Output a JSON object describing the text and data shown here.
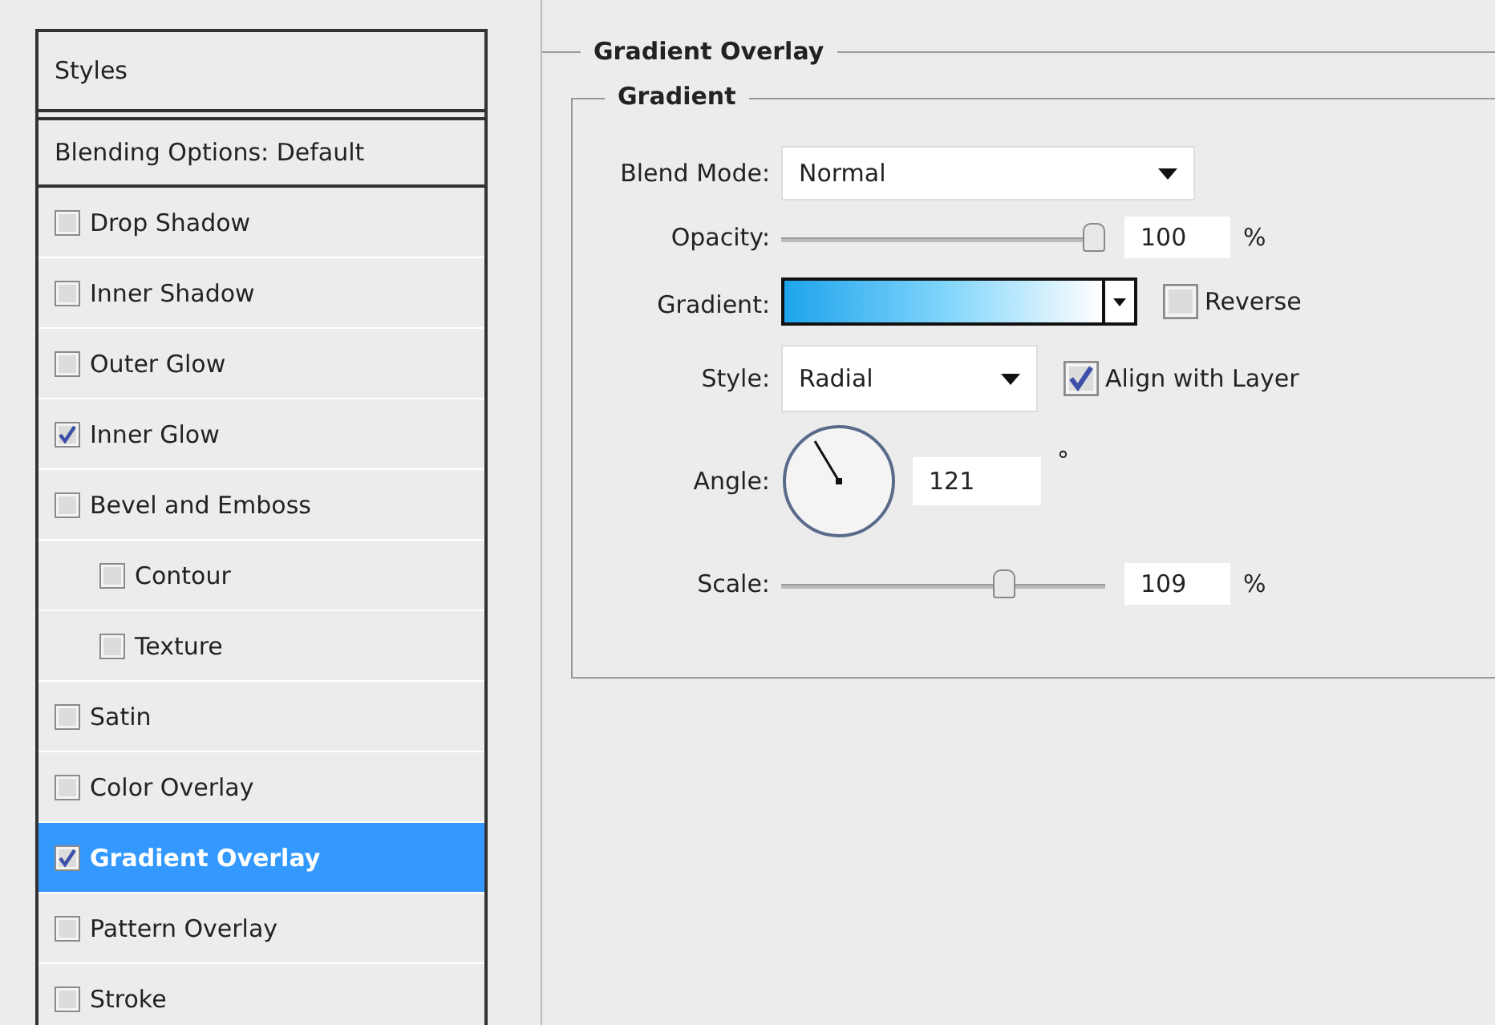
{
  "styles_list": {
    "header": "Styles",
    "items": [
      {
        "kind": "plain",
        "label": "Blending Options: Default",
        "selected": false
      },
      {
        "kind": "checkbox",
        "label": "Drop Shadow",
        "checked": false,
        "selected": false
      },
      {
        "kind": "checkbox",
        "label": "Inner Shadow",
        "checked": false,
        "selected": false
      },
      {
        "kind": "checkbox",
        "label": "Outer Glow",
        "checked": false,
        "selected": false
      },
      {
        "kind": "checkbox",
        "label": "Inner Glow",
        "checked": true,
        "selected": false
      },
      {
        "kind": "checkbox",
        "label": "Bevel and Emboss",
        "checked": false,
        "selected": false,
        "children": [
          {
            "kind": "checkbox",
            "label": "Contour",
            "checked": false,
            "selected": false
          },
          {
            "kind": "checkbox",
            "label": "Texture",
            "checked": false,
            "selected": false
          }
        ]
      },
      {
        "kind": "checkbox",
        "label": "Satin",
        "checked": false,
        "selected": false
      },
      {
        "kind": "checkbox",
        "label": "Color Overlay",
        "checked": false,
        "selected": false
      },
      {
        "kind": "checkbox",
        "label": "Gradient Overlay",
        "checked": true,
        "selected": true
      },
      {
        "kind": "checkbox",
        "label": "Pattern Overlay",
        "checked": false,
        "selected": false
      },
      {
        "kind": "checkbox",
        "label": "Stroke",
        "checked": false,
        "selected": false
      }
    ]
  },
  "panel": {
    "title": "Gradient Overlay",
    "group": "Gradient",
    "blend_mode": {
      "label": "Blend Mode:",
      "value": "Normal"
    },
    "opacity": {
      "label": "Opacity:",
      "level": 1,
      "value": "100",
      "unit": "%"
    },
    "gradient": {
      "label": "Gradient:"
    },
    "reverse": {
      "label": "Reverse",
      "checked": false
    },
    "style": {
      "label": "Style:",
      "value": "Radial"
    },
    "align_with_layer": {
      "label": "Align with Layer",
      "checked": true
    },
    "angle": {
      "label": "Angle:",
      "value": "121",
      "unit": "°"
    },
    "scale": {
      "label": "Scale:",
      "level": 0.7,
      "value": "109",
      "unit": "%"
    }
  }
}
